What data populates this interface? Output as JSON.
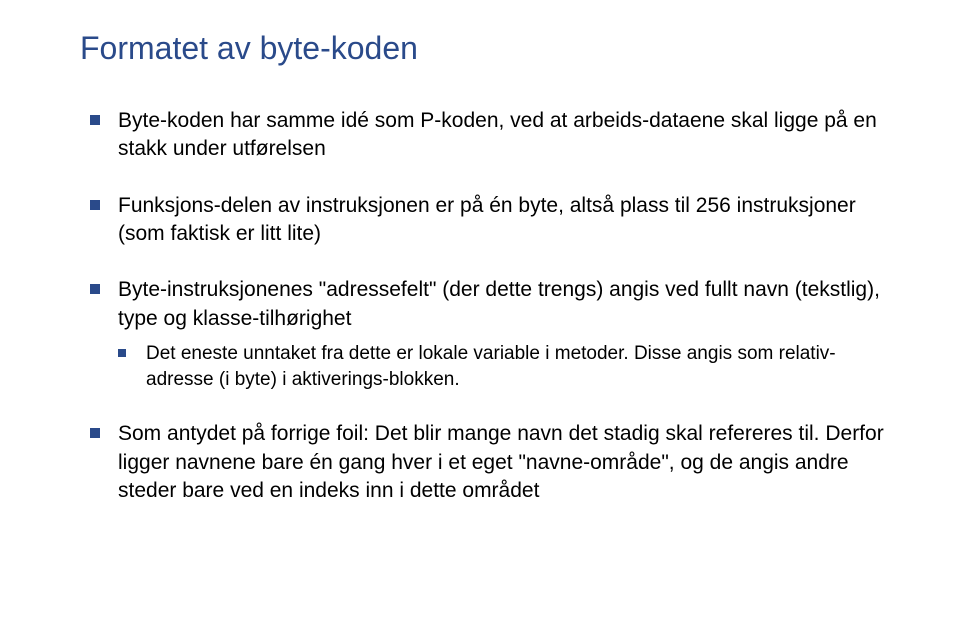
{
  "title": "Formatet av byte-koden",
  "bullets": {
    "item1": "Byte-koden har samme idé som P-koden, ved at arbeids-dataene skal ligge på en stakk under utførelsen",
    "item2": "Funksjons-delen av instruksjonen er på én byte, altså plass til 256 instruksjoner (som faktisk er litt lite)",
    "item3": "Byte-instruksjonenes \"adressefelt\" (der dette trengs) angis ved fullt navn (tekstlig), type og klasse-tilhørighet",
    "item3_sub": "Det eneste unntaket fra dette er lokale variable i metoder.  Disse angis som relativ-adresse (i byte) i aktiverings-blokken.",
    "item4": "Som antydet på forrige foil: Det blir mange navn det stadig skal refereres til.  Derfor ligger navnene bare én gang hver i et eget \"navne-område\", og de angis andre steder bare ved en indeks inn i dette området"
  }
}
